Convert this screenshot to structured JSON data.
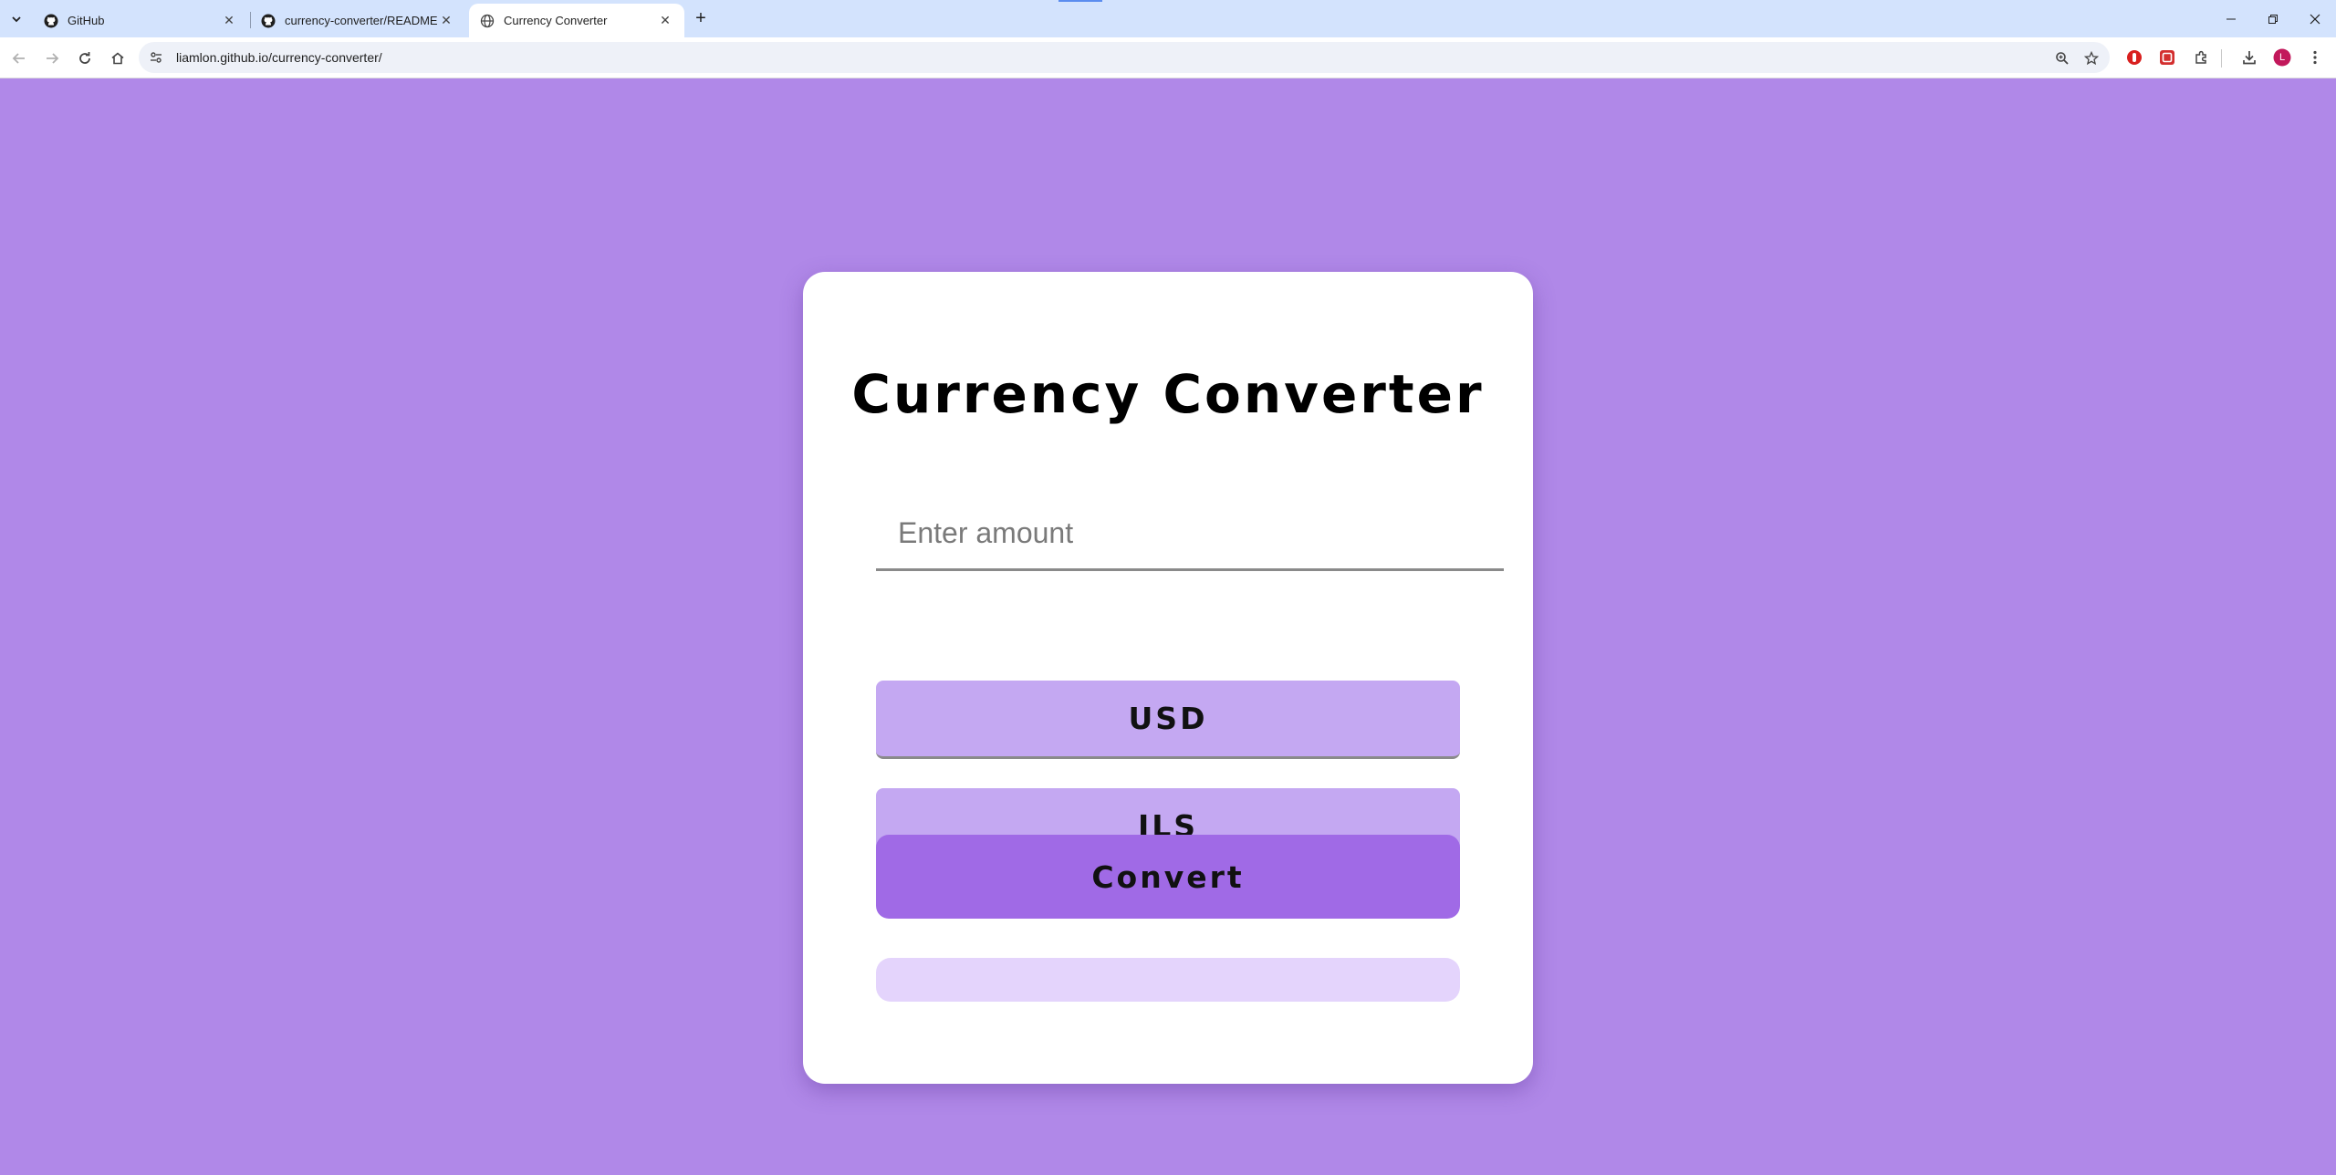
{
  "browser": {
    "tabs": [
      {
        "title": "GitHub",
        "favicon": "github-icon",
        "active": false
      },
      {
        "title": "currency-converter/README.md",
        "favicon": "github-icon",
        "active": false
      },
      {
        "title": "Currency Converter",
        "favicon": "globe-icon",
        "active": true
      }
    ],
    "url": "liamlon.github.io/currency-converter/",
    "profile_initial": "L"
  },
  "page": {
    "title": "Currency Converter",
    "amount_placeholder": "Enter amount",
    "amount_value": "",
    "from_currency": "USD",
    "to_currency": "ILS",
    "convert_label": "Convert",
    "result": ""
  },
  "colors": {
    "background": "#b088e8",
    "card": "#ffffff",
    "select": "#c4a8f2",
    "convert": "#a06ae6",
    "result": "#e4d4fc"
  }
}
